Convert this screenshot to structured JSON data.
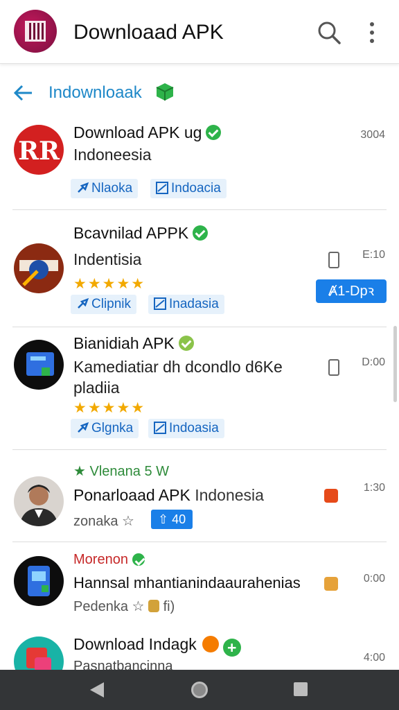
{
  "appbar": {
    "title": "Downloaad APK",
    "icons": [
      "qr-logo-icon",
      "search-icon",
      "more-vert-icon"
    ]
  },
  "back_row": {
    "label": "Indownloaak"
  },
  "items": [
    {
      "title": "Download APK ug",
      "subtitle": "Indoneesia",
      "time": "3004",
      "tags": [
        "Nlaoka",
        "Indoacia"
      ]
    },
    {
      "title": "Bcavnilad APPK",
      "subtitle": "Indentisia",
      "time": "E:10",
      "rating": "★★★★★",
      "open_button": "Ⱥ1-Dpꝛ",
      "tags": [
        "Clipnik",
        "Inadasia"
      ]
    },
    {
      "title": "Bianidiah APK",
      "subtitle_line1": "Kamediatiar dh dcondlo d6Ke",
      "subtitle_line2": "pladiia",
      "time": "D:00",
      "rating": "★★★★★",
      "tags": [
        "Glgnka",
        "Indoasia"
      ]
    },
    {
      "header": "Vlenana 5 W",
      "title": "Ponarloaad APK",
      "title_suffix": "Indonesia",
      "time": "1:30",
      "meta": "zonaka ☆",
      "mini_button": "⇧ 40"
    },
    {
      "header": "Morenon",
      "title": "Hannsal mhantianindaaurahenias",
      "sub": "Pedenka ☆",
      "sub_suffix": "fi)",
      "time": "0:00"
    },
    {
      "title": "Download Indagk",
      "sub": "Pasnatbancinna",
      "time": "4:00"
    }
  ],
  "colors": {
    "accent": "#1a7fe8",
    "link": "#1e88c8",
    "verified": "#2eb34a",
    "star": "#f2a900",
    "navbar": "#333537"
  }
}
